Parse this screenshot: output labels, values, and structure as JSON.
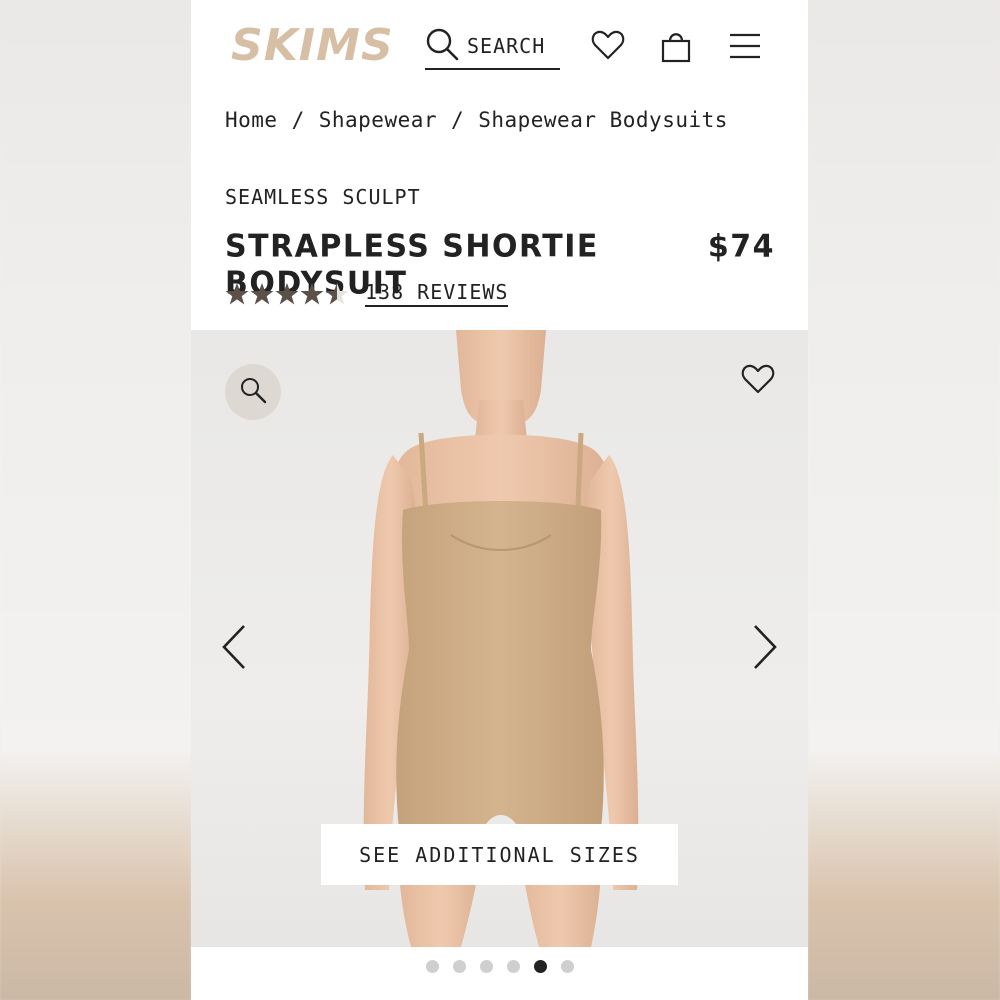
{
  "header": {
    "logo": "SKIMS",
    "search_label": "SEARCH"
  },
  "icons": {
    "search": "search-icon",
    "wishlist": "heart-icon",
    "bag": "shopping-bag-icon",
    "menu": "hamburger-menu-icon",
    "zoom": "magnify-icon",
    "prev": "chevron-left-icon",
    "next": "chevron-right-icon"
  },
  "breadcrumb": {
    "items": [
      "Home",
      "Shapewear",
      "Shapewear Bodysuits"
    ],
    "separator": "/"
  },
  "product": {
    "collection": "SEAMLESS SCULPT",
    "name": "STRAPLESS SHORTIE BODYSUIT",
    "price": "$74",
    "rating": 4.5,
    "rating_max": 5,
    "reviews_label": "138 REVIEWS"
  },
  "gallery": {
    "sizes_button": "SEE ADDITIONAL SIZES",
    "slide_count": 6,
    "active_slide": 5
  },
  "colors": {
    "brand": "#d7bfa6",
    "text": "#222222",
    "star": "#5b5149",
    "product_tone": "#c9a882"
  }
}
